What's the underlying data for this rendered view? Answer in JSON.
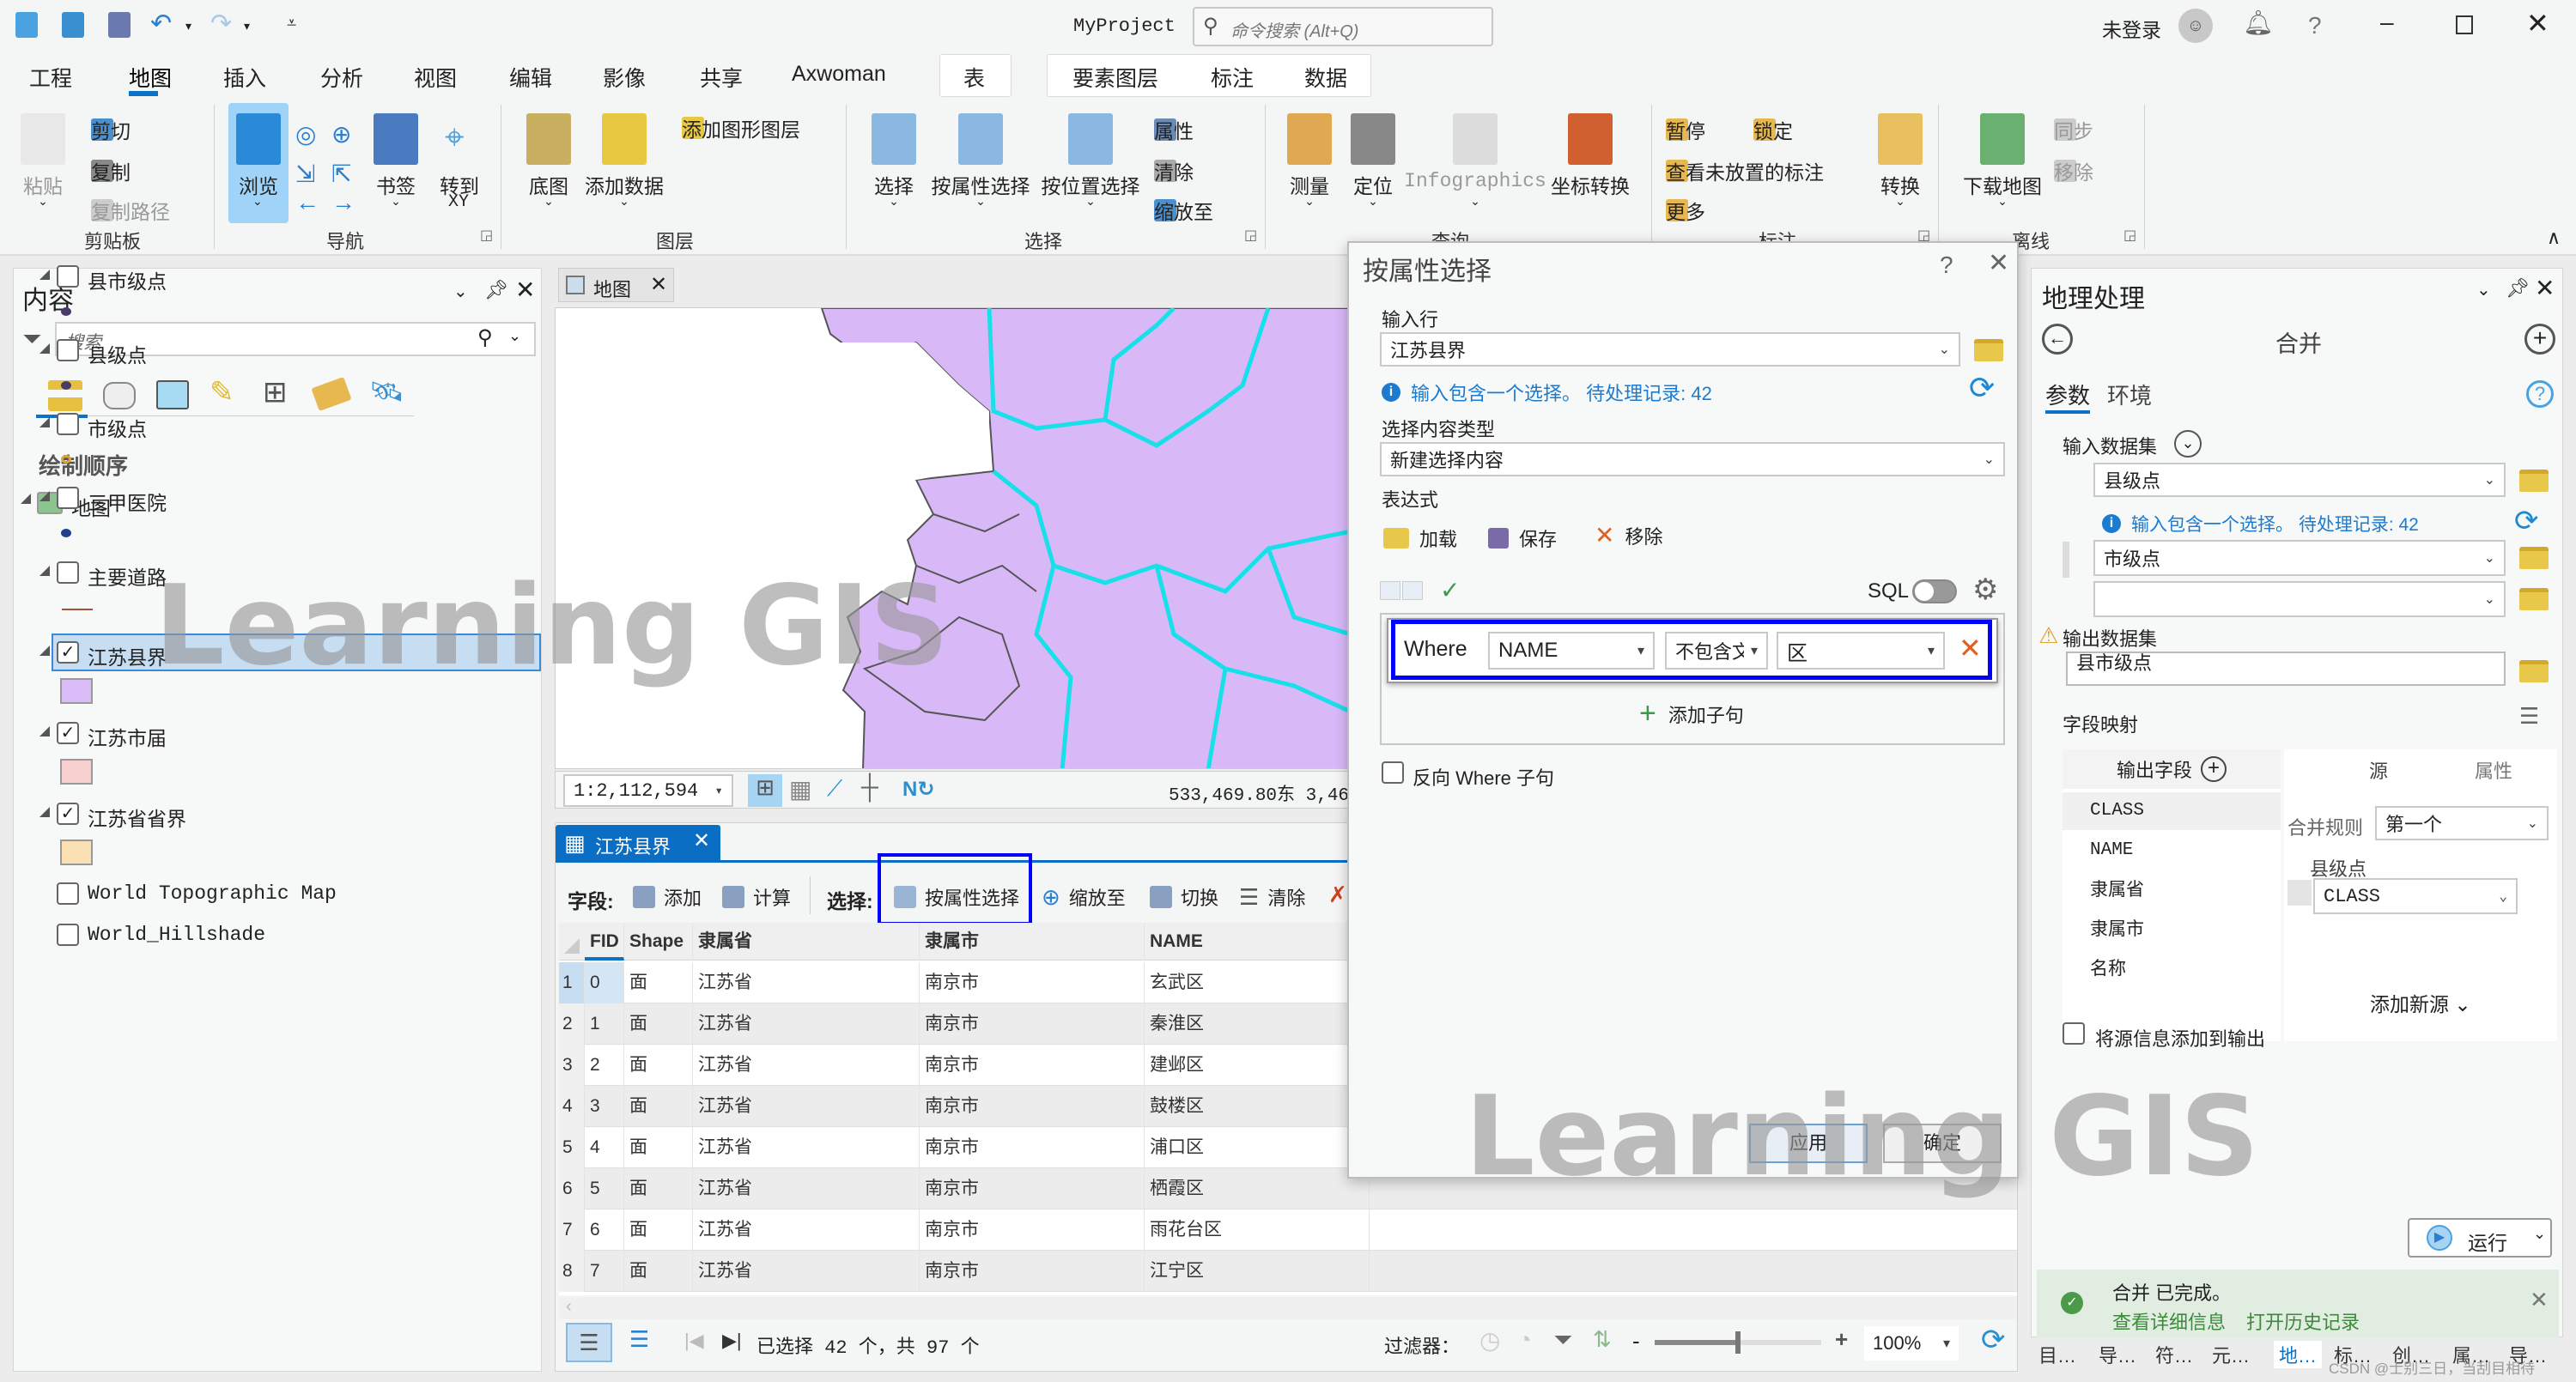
{
  "app": {
    "project": "MyProject",
    "search_placeholder": "命令搜索 (Alt+Q)",
    "user": "未登录",
    "accent": "#0b72c5"
  },
  "tabs": [
    "工程",
    "地图",
    "插入",
    "分析",
    "视图",
    "编辑",
    "影像",
    "共享",
    "Axwoman",
    "表",
    "要素图层",
    "标注",
    "数据"
  ],
  "active_tab": "地图",
  "ribbon": {
    "groups": {
      "clipboard": "剪贴板",
      "navigate": "导航",
      "layer": "图层",
      "selection": "选择",
      "inquiry": "查询",
      "labeling": "标注",
      "offline": "离线"
    },
    "paste": "粘贴",
    "cut": "剪切",
    "copy": "复制",
    "copy_path": "复制路径",
    "explore": "浏览",
    "bookmarks": "书签",
    "goto": "转到",
    "goto_xy": "XY",
    "basemap": "底图",
    "add_data": "添加数据",
    "add_graphics_layer": "添加图形图层",
    "select": "选择",
    "select_by_attr": "按属性选择",
    "select_by_location": "按位置选择",
    "attributes": "属性",
    "clear": "清除",
    "zoom_to": "缩放至",
    "measure": "测量",
    "locate": "定位",
    "infographics": "Infographics",
    "convert_coords": "坐标转换",
    "pause": "暂停",
    "lock": "锁定",
    "view_unplaced": "查看未放置的标注",
    "more": "更多",
    "convert": "转换",
    "download_map": "下载地图",
    "sync": "同步",
    "remove": "移除"
  },
  "contents": {
    "title": "内容",
    "search_placeholder": "搜索",
    "section": "绘制顺序",
    "map": "地图",
    "layers": [
      {
        "name": "县市级点",
        "checked": false,
        "symbol": "dot",
        "color": "#4a3a6a"
      },
      {
        "name": "县级点",
        "checked": false,
        "symbol": "dot",
        "color": "#4a3a6a"
      },
      {
        "name": "市级点",
        "checked": false,
        "symbol": "ring",
        "color": "#d9a53a"
      },
      {
        "name": "三甲医院",
        "checked": false,
        "symbol": "dot",
        "color": "#1f3f8a"
      },
      {
        "name": "主要道路",
        "checked": false,
        "symbol": "line",
        "color": "#a0523a"
      },
      {
        "name": "江苏县界",
        "checked": true,
        "symbol": "fill",
        "color": "#dcbcf8",
        "selected": true
      },
      {
        "name": "江苏市届",
        "checked": true,
        "symbol": "fill",
        "color": "#f8d0d0"
      },
      {
        "name": "江苏省省界",
        "checked": true,
        "symbol": "fill",
        "color": "#fbe0b4"
      },
      {
        "name": "World Topographic Map",
        "checked": false
      },
      {
        "name": "World_Hillshade",
        "checked": false
      }
    ]
  },
  "map_view": {
    "tab": "地图",
    "scale": "1:2,112,594",
    "coords": "533,469.80东 3,46",
    "fill_color": "#d9b8f8",
    "boundary_color": "#19e0e8"
  },
  "table": {
    "tab": "江苏县界",
    "fields_label": "字段:",
    "add": "添加",
    "calculate": "计算",
    "selection_label": "选择:",
    "select_by_attr": "按属性选择",
    "zoom_to": "缩放至",
    "switch": "切换",
    "clear": "清除",
    "columns": [
      "FID",
      "Shape",
      "隶属省",
      "隶属市",
      "NAME"
    ],
    "rows": [
      [
        "0",
        "面",
        "江苏省",
        "南京市",
        "玄武区"
      ],
      [
        "1",
        "面",
        "江苏省",
        "南京市",
        "秦淮区"
      ],
      [
        "2",
        "面",
        "江苏省",
        "南京市",
        "建邺区"
      ],
      [
        "3",
        "面",
        "江苏省",
        "南京市",
        "鼓楼区"
      ],
      [
        "4",
        "面",
        "江苏省",
        "南京市",
        "浦口区"
      ],
      [
        "5",
        "面",
        "江苏省",
        "南京市",
        "栖霞区"
      ],
      [
        "6",
        "面",
        "江苏省",
        "南京市",
        "雨花台区"
      ],
      [
        "7",
        "面",
        "江苏省",
        "南京市",
        "江宁区"
      ]
    ],
    "status": "已选择 42 个，共 97 个",
    "filter_label": "过滤器：",
    "zoom": "100%",
    "zoom_slider_percent": 50
  },
  "dialog": {
    "title": "按属性选择",
    "input_rows_label": "输入行",
    "input_rows": "江苏县界",
    "info": "输入包含一个选择。 待处理记录: 42",
    "selection_type_label": "选择内容类型",
    "selection_type": "新建选择内容",
    "expression_label": "表达式",
    "load": "加载",
    "save": "保存",
    "remove": "移除",
    "sql": "SQL",
    "sql_on": false,
    "where": "Where",
    "field": "NAME",
    "operator": "不包含文",
    "value": "区",
    "add_clause": "添加子句",
    "invert": "反向 Where 子句",
    "invert_checked": false,
    "apply": "应用",
    "ok": "确定"
  },
  "geoprocessing": {
    "title": "地理处理",
    "tool": "合并",
    "tab_params": "参数",
    "tab_env": "环境",
    "input_label": "输入数据集",
    "inputs": [
      "县级点",
      "市级点",
      ""
    ],
    "info": "输入包含一个选择。 待处理记录: 42",
    "output_label": "输出数据集",
    "output": "县市级点",
    "field_map_label": "字段映射",
    "out_fields_header": "输出字段",
    "source_tab": "源",
    "props_tab": "属性",
    "fields": [
      "CLASS",
      "NAME",
      "隶属省",
      "隶属市",
      "名称"
    ],
    "merge_rule_label": "合并规则",
    "merge_rule": "第一个",
    "source_name": "县级点",
    "source_field": "CLASS",
    "add_source": "添加新源",
    "add_source_info": "将源信息添加到输出",
    "add_source_info_checked": false,
    "run": "运行",
    "done": "合并 已完成。",
    "details": "查看详细信息",
    "history": "打开历史记录"
  },
  "bottom_tabs": [
    "目…",
    "导…",
    "符…",
    "元…",
    "地…",
    "标…",
    "创…",
    "属…",
    "导…"
  ],
  "bottom_active": "地…",
  "watermark": "Learning GIS",
  "credit": "CSDN @士别三日，当刮目相待"
}
